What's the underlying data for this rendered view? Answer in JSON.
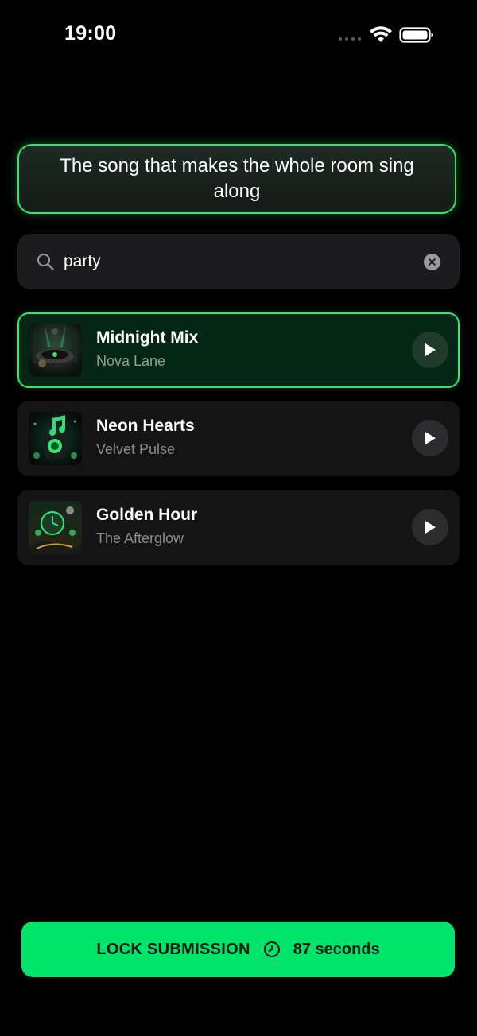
{
  "status_bar": {
    "time": "19:00"
  },
  "prompt": {
    "text": "The song that makes the whole room sing along"
  },
  "search": {
    "value": "party",
    "placeholder": "",
    "icon": "search-icon",
    "clear_icon": "clear-icon"
  },
  "songs": [
    {
      "title": "Midnight Mix",
      "artist": "Nova Lane",
      "selected": true,
      "icon": "play-icon"
    },
    {
      "title": "Neon Hearts",
      "artist": "Velvet Pulse",
      "selected": false,
      "icon": "play-icon"
    },
    {
      "title": "Golden Hour",
      "artist": "The Afterglow",
      "selected": false,
      "icon": "play-icon"
    }
  ],
  "footer": {
    "lock_label": "LOCK SUBMISSION",
    "timer_text": "87 seconds",
    "timer_icon": "clock-icon"
  },
  "colors": {
    "accent": "#00e46c",
    "selected_border": "#2ee86f",
    "background": "#000000"
  }
}
